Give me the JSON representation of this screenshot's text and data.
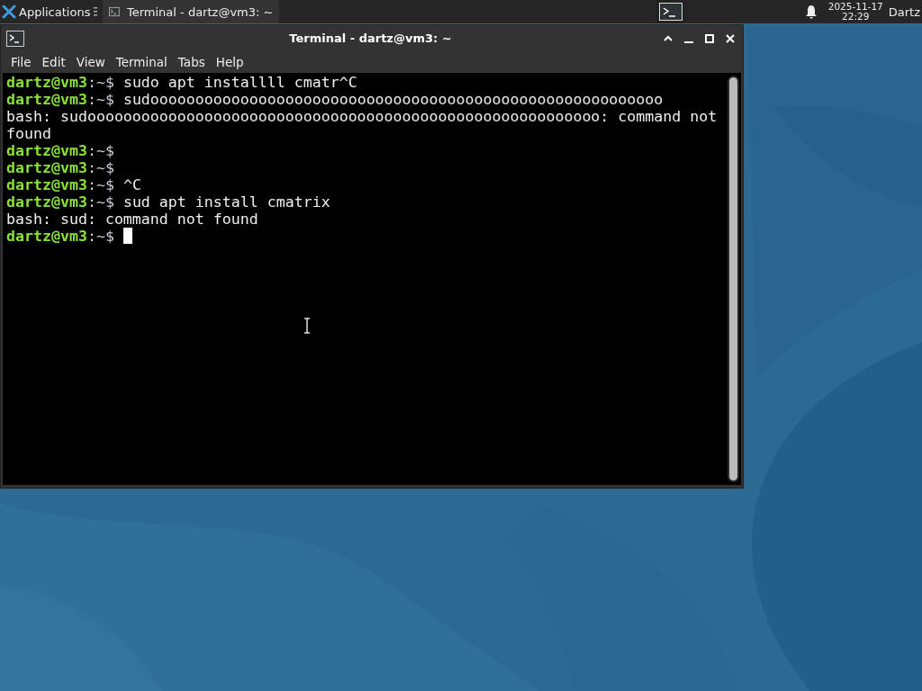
{
  "panel": {
    "apps_label": "Applications",
    "tasks": [
      {
        "label": "Terminal - dartz@vm3: ~",
        "selected": true
      }
    ],
    "clock_date": "2025-11-17",
    "clock_time": "22:29",
    "user": "Dartz"
  },
  "window": {
    "title": "Terminal - dartz@vm3: ~",
    "menu": [
      "File",
      "Edit",
      "View",
      "Terminal",
      "Tabs",
      "Help"
    ]
  },
  "terminal": {
    "lines": [
      {
        "kind": "prompt",
        "user": "dartz@vm3",
        "path": ":~$",
        "command": "sudo apt installll cmatr^C"
      },
      {
        "kind": "prompt",
        "user": "dartz@vm3",
        "path": ":~$",
        "command": "sudooooooooooooooooooooooooooooooooooooooooooooooooooooooooo"
      },
      {
        "kind": "output",
        "text": "bash: sudooooooooooooooooooooooooooooooooooooooooooooooooooooooooo: command not found"
      },
      {
        "kind": "prompt",
        "user": "dartz@vm3",
        "path": ":~$"
      },
      {
        "kind": "prompt",
        "user": "dartz@vm3",
        "path": ":~$"
      },
      {
        "kind": "prompt",
        "user": "dartz@vm3",
        "path": ":~$",
        "command": "^C"
      },
      {
        "kind": "prompt",
        "user": "dartz@vm3",
        "path": ":~$",
        "command": "sud apt install cmatrix"
      },
      {
        "kind": "output",
        "text": "bash: sud: command not found"
      },
      {
        "kind": "prompt",
        "user": "dartz@vm3",
        "path": ":~$",
        "cursor": true
      }
    ]
  }
}
